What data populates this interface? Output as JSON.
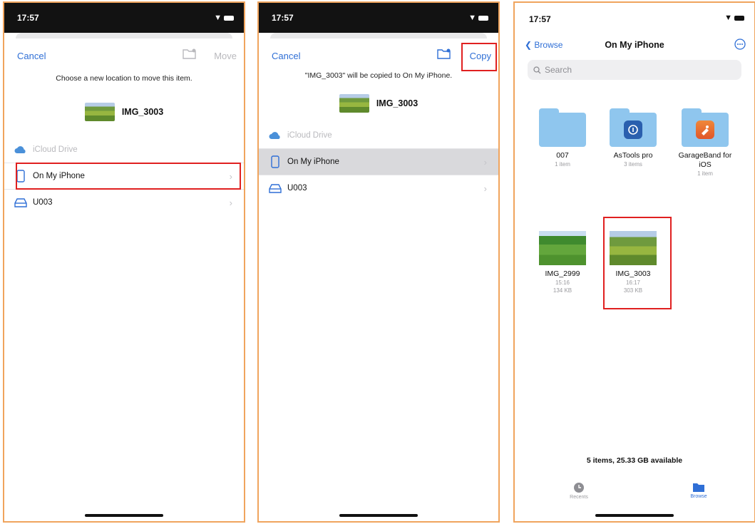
{
  "status": {
    "time": "17:57"
  },
  "panel1": {
    "cancel": "Cancel",
    "action": "Move",
    "subtitle": "Choose a new location to move this item.",
    "item_name": "IMG_3003",
    "locations": [
      {
        "label": "iCloud Drive",
        "icon": "cloud-icon",
        "disabled": true
      },
      {
        "label": "On My iPhone",
        "icon": "iphone-icon"
      },
      {
        "label": "U003",
        "icon": "drive-icon"
      }
    ]
  },
  "panel2": {
    "cancel": "Cancel",
    "action": "Copy",
    "subtitle": "\"IMG_3003\" will be copied to On My iPhone.",
    "item_name": "IMG_3003",
    "locations": [
      {
        "label": "iCloud Drive",
        "icon": "cloud-icon",
        "disabled": true
      },
      {
        "label": "On My iPhone",
        "icon": "iphone-icon",
        "selected": true
      },
      {
        "label": "U003",
        "icon": "drive-icon"
      }
    ]
  },
  "panel3": {
    "back": "Browse",
    "title": "On My iPhone",
    "search_placeholder": "Search",
    "folders": [
      {
        "name": "007",
        "sub": "1 item"
      },
      {
        "name": "AsTools pro",
        "sub": "3 items"
      },
      {
        "name": "GarageBand for iOS",
        "sub": "1 item"
      }
    ],
    "files": [
      {
        "name": "IMG_2999",
        "time": "15:16",
        "size": "134 KB"
      },
      {
        "name": "IMG_3003",
        "time": "16:17",
        "size": "303 KB"
      }
    ],
    "summary": "5 items, 25.33 GB available",
    "tabs": [
      {
        "label": "Recents",
        "icon": "clock-icon"
      },
      {
        "label": "Browse",
        "icon": "folder-icon",
        "active": true
      }
    ]
  },
  "colors": {
    "accent": "#2f6fd6",
    "highlight": "#e02020",
    "frame": "#F0A45D"
  }
}
